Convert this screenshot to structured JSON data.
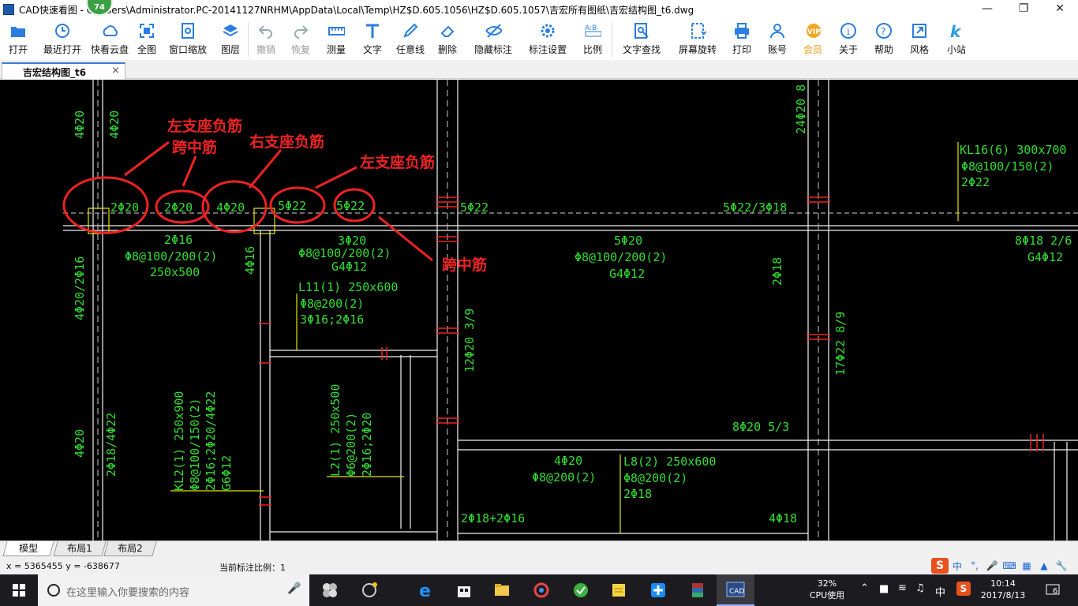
{
  "window": {
    "title": "CAD快速看图 - C:\\Users\\Administrator.PC-20141127NRHM\\AppData\\Local\\Temp\\HZ$D.605.1056\\HZ$D.605.1057\\吉宏所有图纸\\吉宏结构图_t6.dwg",
    "badge": "74"
  },
  "toolbar": [
    {
      "id": "open",
      "label": "打开",
      "icon": "folder-open-icon"
    },
    {
      "id": "recent",
      "label": "最近打开",
      "icon": "history-clock-icon"
    },
    {
      "id": "cloud",
      "label": "快看云盘",
      "icon": "cloud-icon"
    },
    {
      "id": "fullview",
      "label": "全图",
      "icon": "fullscreen-icon"
    },
    {
      "id": "zoomwin",
      "label": "窗口缩放",
      "icon": "zoom-window-icon"
    },
    {
      "id": "layers",
      "label": "图层",
      "icon": "layers-icon"
    },
    {
      "id": "undo",
      "label": "撤销",
      "icon": "undo-icon",
      "disabled": true
    },
    {
      "id": "redo",
      "label": "恢复",
      "icon": "redo-icon",
      "disabled": true
    },
    {
      "id": "measure",
      "label": "测量",
      "icon": "ruler-icon"
    },
    {
      "id": "text",
      "label": "文字",
      "icon": "text-t-icon"
    },
    {
      "id": "freeline",
      "label": "任意线",
      "icon": "pen-icon"
    },
    {
      "id": "delete",
      "label": "删除",
      "icon": "eraser-icon"
    },
    {
      "id": "hidemark",
      "label": "隐藏标注",
      "icon": "eye-hidden-icon"
    },
    {
      "id": "marksettings",
      "label": "标注设置",
      "icon": "gear-icon"
    },
    {
      "id": "ratio",
      "label": "比例",
      "icon": "scale-ratio-icon"
    },
    {
      "id": "findtext",
      "label": "文字查找",
      "icon": "find-text-icon"
    },
    {
      "id": "rotate",
      "label": "屏幕旋转",
      "icon": "rotate-screen-icon"
    },
    {
      "id": "print",
      "label": "打印",
      "icon": "printer-icon"
    },
    {
      "id": "account",
      "label": "账号",
      "icon": "user-icon"
    },
    {
      "id": "vip",
      "label": "会员",
      "icon": "vip-icon"
    },
    {
      "id": "about",
      "label": "关于",
      "icon": "info-icon"
    },
    {
      "id": "help",
      "label": "帮助",
      "icon": "help-question-icon"
    },
    {
      "id": "style",
      "label": "风格",
      "icon": "style-expand-icon"
    },
    {
      "id": "site",
      "label": "小站",
      "icon": "k-logo-icon"
    }
  ],
  "doc_tab": {
    "label": "吉宏结构图_t6",
    "close": "×"
  },
  "drawing": {
    "annotations_red": [
      "左支座负筋",
      "跨中筋",
      "右支座负筋",
      "左支座负筋",
      "跨中筋"
    ],
    "labels": {
      "a1": "4Φ20",
      "a2": "4Φ20",
      "a3": "2Φ20",
      "a4": "2Φ20",
      "a5": "4Φ20",
      "a6": "5Φ22",
      "a7": "5Φ22",
      "a8": "5Φ22",
      "a9": "5Φ22/3Φ18",
      "a10": "KL16(6) 300x700",
      "a11": "Φ8@100/150(2)",
      "a12": "2Φ22",
      "a13": "2Φ16",
      "a14": "Φ8@100/200(2)",
      "a15": "250x500",
      "a16": "3Φ20",
      "a17": "Φ8@100/200(2)",
      "a18": "G4Φ12",
      "a19": "5Φ20",
      "a20": "Φ8@100/200(2)",
      "a21": "G4Φ12",
      "a22": "8Φ18 2/6",
      "a23": "G4Φ12",
      "a24": "L11(1) 250x600",
      "a25": "Φ8@200(2)",
      "a26": "3Φ16;2Φ16",
      "a27": "24Φ20 8",
      "a28": "2Φ18",
      "a29": "4Φ20/2Φ16",
      "a30": "4Φ16",
      "a31": "12Φ20 3/9",
      "a32": "17Φ22 8/9",
      "a33": "KL2(1) 250x900",
      "a34": "Φ8@100/150(2)",
      "a35": "2Φ16;2Φ20/4Φ22",
      "a36": "G6Φ12",
      "a37": "L2(1) 250x500",
      "a38": "Φ6@200(2)",
      "a39": "2Φ16;2Φ20",
      "a40": "2Φ18/4Φ22",
      "a41": "4Φ20",
      "a42": "8Φ20 5/3",
      "a43": "4Φ20",
      "a44": "Φ8@200(2)",
      "a45": "L8(2) 250x600",
      "a46": "Φ8@200(2)",
      "a47": "2Φ18",
      "a48": "2Φ18+2Φ16",
      "a49": "4Φ18"
    }
  },
  "layout_tabs": [
    "模型",
    "布局1",
    "布局2"
  ],
  "status": {
    "coords": "x = 5365455  y = -638677",
    "scale": "当前标注比例：1"
  },
  "ime": {
    "s_label": "S",
    "lang": "中",
    "punct": "°,"
  },
  "taskbar": {
    "search_placeholder": "在这里输入你要搜索的内容",
    "cpu_percent": "32%",
    "cpu_label": "CPU使用",
    "lang": "中",
    "time": "10:14",
    "date": "2017/8/13",
    "notifications": "6"
  },
  "colors": {
    "drawing_green": "#33dd33",
    "annotation_red": "#ee2222",
    "canvas_bg": "#000000"
  }
}
